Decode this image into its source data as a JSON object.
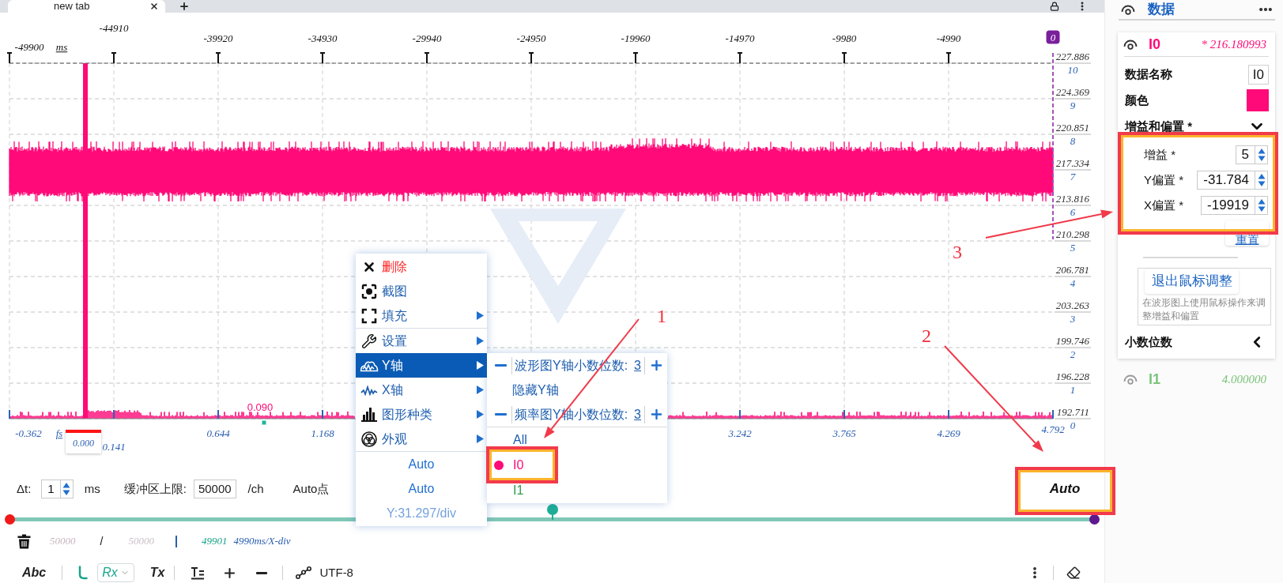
{
  "browser": {
    "tabs": [
      {
        "title": "new tab",
        "selected": true
      }
    ]
  },
  "chart": {
    "top_axis": {
      "labels": [
        "-49900",
        "-44910",
        "-39920",
        "-34930",
        "-29940",
        "-24950",
        "-19960",
        "-14970",
        "-9980",
        "-4990"
      ],
      "unit": "ms",
      "end_badge": "0"
    },
    "right_axis": [
      {
        "value": "227.886",
        "division": "10"
      },
      {
        "value": "224.369",
        "division": "9"
      },
      {
        "value": "220.851",
        "division": "8"
      },
      {
        "value": "217.334",
        "division": "7"
      },
      {
        "value": "213.816",
        "division": "6"
      },
      {
        "value": "210.298",
        "division": "5"
      },
      {
        "value": "206.781",
        "division": "4"
      },
      {
        "value": "203.263",
        "division": "3"
      },
      {
        "value": "199.746",
        "division": "2"
      },
      {
        "value": "196.228",
        "division": "1"
      },
      {
        "value": "192.711",
        "division": "0"
      }
    ],
    "bottom_axis": {
      "labels": [
        "-0.362",
        "0.141",
        "0.644",
        "1.168",
        "3.242",
        "3.765",
        "4.269",
        "4.792"
      ],
      "unit": "fs",
      "cursor": "0.000"
    },
    "peak_label": "0.090"
  },
  "context_menu": {
    "actions": [
      {
        "label": "删除",
        "danger": true,
        "submenu": false
      },
      {
        "label": "截图",
        "danger": false,
        "submenu": false
      },
      {
        "label": "填充",
        "danger": false,
        "submenu": true
      }
    ],
    "settings": [
      {
        "label": "设置",
        "selected": false,
        "submenu": true
      },
      {
        "label": "Y轴",
        "selected": true,
        "submenu": true
      },
      {
        "label": "X轴",
        "selected": false,
        "submenu": true
      },
      {
        "label": "图形种类",
        "selected": false,
        "submenu": true
      },
      {
        "label": "外观",
        "selected": false,
        "submenu": true
      }
    ],
    "readouts": [
      {
        "label": "Auto",
        "muted": false
      },
      {
        "label": "Auto",
        "muted": false
      },
      {
        "label": "Y:31.297/div",
        "muted": true
      }
    ]
  },
  "y_axis_submenu": {
    "rows": [
      {
        "kind": "stepper",
        "label": "波形图Y轴小数位数:",
        "value": "3"
      },
      {
        "kind": "action",
        "label": "隐藏Y轴"
      },
      {
        "kind": "stepper",
        "label": "频率图Y轴小数位数:",
        "value": "3"
      }
    ],
    "channels": [
      {
        "label": "All",
        "selected": false,
        "color": "#1f5fae"
      },
      {
        "label": "I0",
        "selected": true,
        "color": "#ff0a78"
      },
      {
        "label": "I1",
        "selected": false,
        "color": "#2e9e4f"
      }
    ]
  },
  "controls": {
    "dt": {
      "label": "Δt:",
      "value": "1",
      "unit": "ms"
    },
    "buffer": {
      "label": "缓冲区上限:",
      "value": "50000",
      "unit": "/ch"
    },
    "auto_points_label": "Auto点",
    "auto_button": "Auto"
  },
  "timeline": {
    "level": 0.5
  },
  "buffer_status": {
    "used": "50000",
    "separator": "/",
    "capacity": "50000",
    "points": "49901",
    "scale": "4990ms/X-div"
  },
  "toolbar": {
    "format_button": "Abc",
    "rx": {
      "label": "Rx",
      "selected": true
    },
    "tx_button": "Tx",
    "encoding": "UTF-8"
  },
  "data_panel": {
    "title": "数据",
    "channels": [
      {
        "name": "I0",
        "reading": "* 216.180993",
        "color": "#ff0a78",
        "expanded": true,
        "details": {
          "name_label": "数据名称",
          "name_value": "I0",
          "color_label": "颜色",
          "sections": [
            {
              "title": "增益和偏置 *",
              "expanded": true,
              "fields": [
                {
                  "label": "增益 *",
                  "value": "5"
                },
                {
                  "label": "Y偏置 *",
                  "value": "-31.784"
                },
                {
                  "label": "X偏置 *",
                  "value": "-19919"
                }
              ],
              "reset_button": "重置",
              "mouse_adjust_button": "退出鼠标调整",
              "hint": "在波形图上使用鼠标操作来调整增益和偏置"
            },
            {
              "title": "小数位数",
              "expanded": false
            }
          ]
        }
      },
      {
        "name": "I1",
        "reading": "4.000000",
        "color": "#7cc47a",
        "expanded": false
      }
    ]
  },
  "annotations": [
    {
      "number": "1"
    },
    {
      "number": "2"
    },
    {
      "number": "3"
    }
  ]
}
